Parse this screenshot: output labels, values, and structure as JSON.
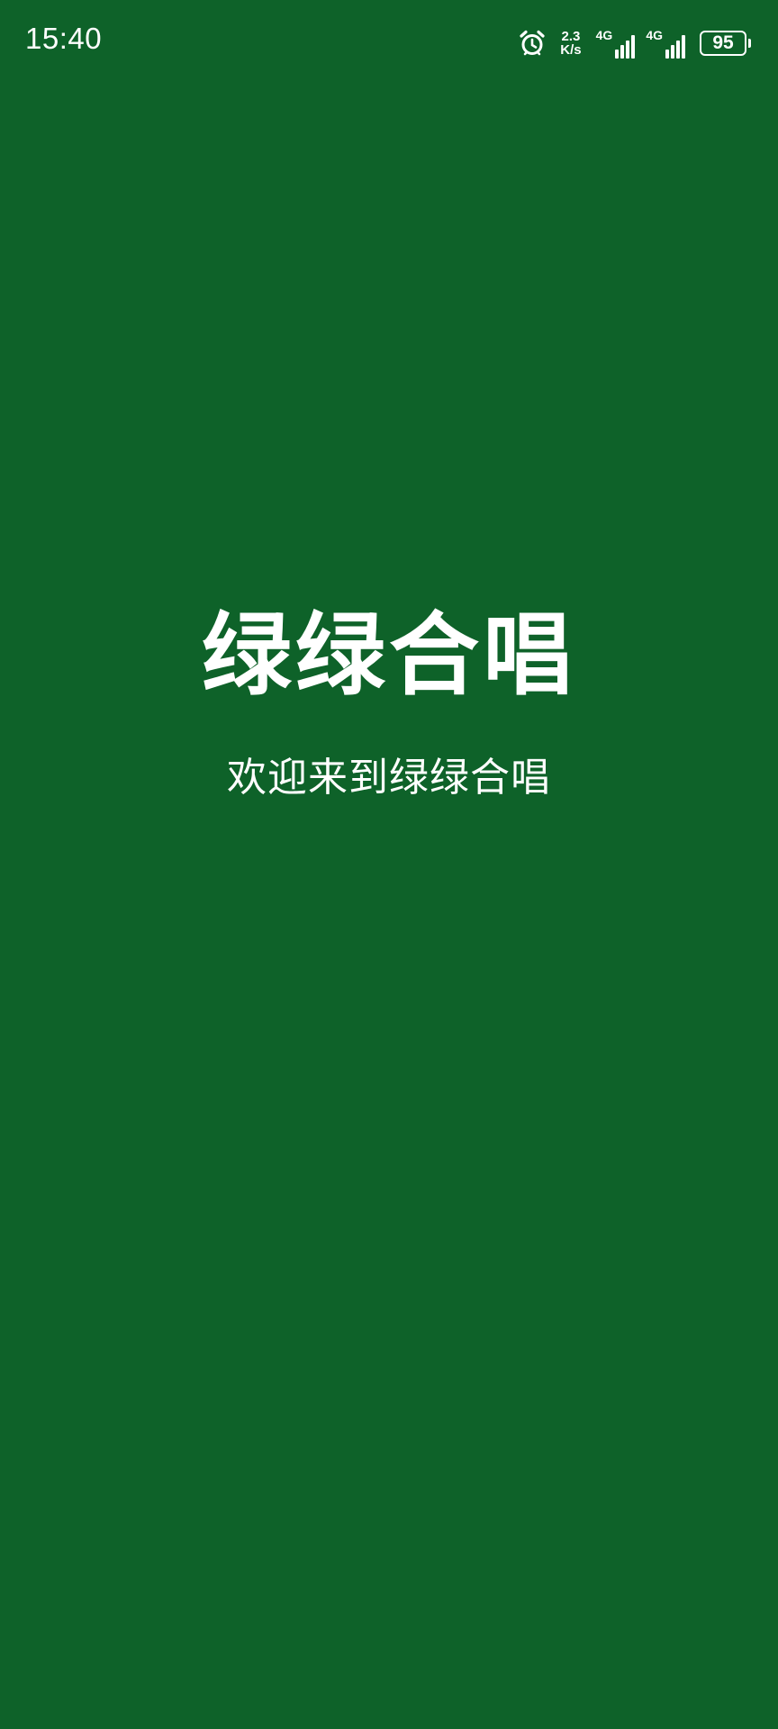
{
  "status_bar": {
    "time": "15:40",
    "network_speed_value": "2.3",
    "network_speed_unit": "K/s",
    "sim1_type": "4G",
    "sim2_type": "4G",
    "battery_level": "95",
    "icons": [
      "alarm-icon",
      "signal-icon",
      "signal-icon",
      "battery-icon"
    ]
  },
  "splash": {
    "app_title": "绿绿合唱",
    "welcome_message": "欢迎来到绿绿合唱"
  },
  "colors": {
    "background": "#0e6229",
    "text": "#ffffff"
  }
}
